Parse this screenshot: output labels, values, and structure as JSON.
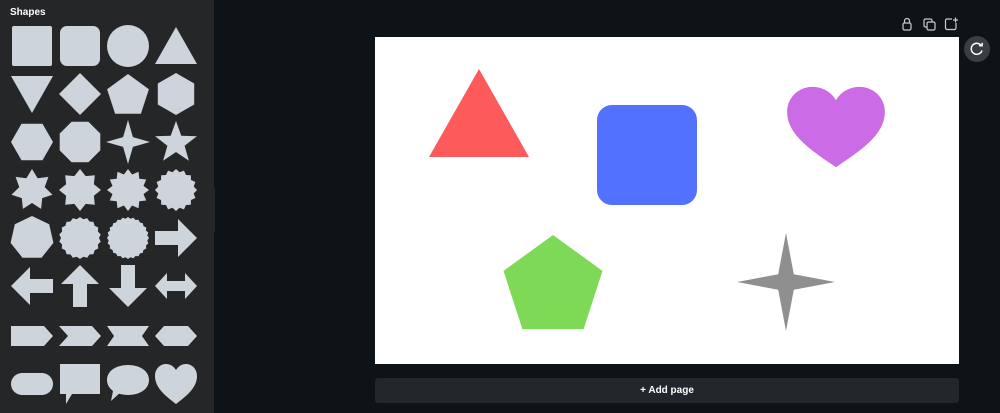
{
  "sidebar": {
    "title": "Shapes",
    "shape_color": "#ced4db",
    "shapes": [
      "square",
      "rounded-square",
      "circle",
      "triangle",
      "triangle-down",
      "diamond",
      "pentagon",
      "hexagon",
      "hexagon-flat",
      "octagon",
      "star-4",
      "star-5",
      "star-7",
      "burst-8",
      "burst-12",
      "burst-16",
      "heptagon",
      "scallop-circle",
      "scallop-circle-fine",
      "arrow-right",
      "arrow-left",
      "arrow-up",
      "arrow-down",
      "arrow-left-right",
      "pentagon-tag",
      "chevron",
      "ribbon-banner",
      "hexagon-long",
      "pill",
      "speech-bubble-rect",
      "speech-bubble-round",
      "heart"
    ]
  },
  "toolbar": {
    "lock_icon": "lock-icon",
    "duplicate_icon": "duplicate-icon",
    "add_icon": "add-page-icon"
  },
  "canvas": {
    "background": "#ffffff",
    "elements": [
      {
        "shape": "triangle",
        "color": "#fd5b5b"
      },
      {
        "shape": "rounded-square",
        "color": "#5271ff"
      },
      {
        "shape": "heart",
        "color": "#cb6ce6"
      },
      {
        "shape": "pentagon",
        "color": "#7ed957"
      },
      {
        "shape": "star-4",
        "color": "#8f8f8f"
      }
    ]
  },
  "add_page_label": "+ Add page"
}
